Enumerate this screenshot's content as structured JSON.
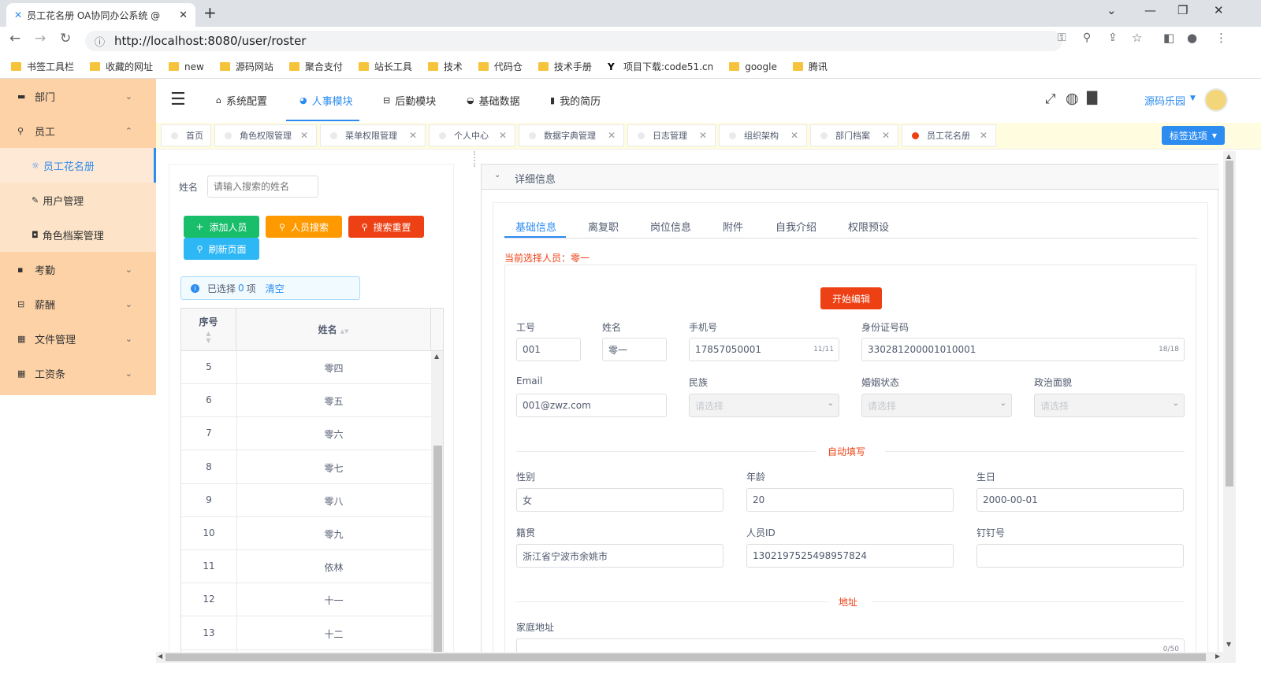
{
  "browser": {
    "tab_title": "员工花名册 OA协同办公系统 @",
    "url": "http://localhost:8080/user/roster",
    "bookmarks": [
      "书签工具栏",
      "收藏的网址",
      "new",
      "源码网站",
      "聚合支付",
      "站长工具",
      "技术",
      "代码仓",
      "技术手册",
      "项目下载:code51.cn",
      "google",
      "腾讯"
    ]
  },
  "sidebar": {
    "items": [
      {
        "label": "部门"
      },
      {
        "label": "员工"
      },
      {
        "label": "员工花名册"
      },
      {
        "label": "用户管理"
      },
      {
        "label": "角色档案管理"
      },
      {
        "label": "考勤"
      },
      {
        "label": "薪酬"
      },
      {
        "label": "文件管理"
      },
      {
        "label": "工资条"
      }
    ]
  },
  "header": {
    "nav": [
      "系统配置",
      "人事模块",
      "后勤模块",
      "基础数据",
      "我的简历"
    ],
    "user": "源码乐园"
  },
  "tags": {
    "items": [
      "首页",
      "角色权限管理",
      "菜单权限管理",
      "个人中心",
      "数据字典管理",
      "日志管理",
      "组织架构",
      "部门档案",
      "员工花名册"
    ],
    "options_label": "标签选项"
  },
  "left": {
    "search_label": "姓名",
    "search_placeholder": "请输入搜索的姓名",
    "buttons": {
      "add": "添加人员",
      "search": "人员搜索",
      "reset": "搜索重置",
      "refresh": "刷新页面"
    },
    "selected_prefix": "已选择",
    "selected_count": "0",
    "selected_suffix": "项",
    "clear": "清空",
    "columns": [
      "序号",
      "姓名"
    ],
    "rows": [
      [
        "5",
        "零四"
      ],
      [
        "6",
        "零五"
      ],
      [
        "7",
        "零六"
      ],
      [
        "8",
        "零七"
      ],
      [
        "9",
        "零八"
      ],
      [
        "10",
        "零九"
      ],
      [
        "11",
        "依林"
      ],
      [
        "12",
        "十一"
      ],
      [
        "13",
        "十二"
      ]
    ]
  },
  "right": {
    "panel_title": "详细信息",
    "tabs": [
      "基础信息",
      "离复职",
      "岗位信息",
      "附件",
      "自我介绍",
      "权限预设"
    ],
    "current_person": "当前选择人员：零一",
    "edit_button": "开始编辑",
    "fields": {
      "work_no": {
        "label": "工号",
        "value": "001"
      },
      "name": {
        "label": "姓名",
        "value": "零一"
      },
      "mobile": {
        "label": "手机号",
        "value": "17857050001",
        "count": "11/11"
      },
      "id_card": {
        "label": "身份证号码",
        "value": "330281200001010001",
        "count": "18/18"
      },
      "email": {
        "label": "Email",
        "value": "001@zwz.com"
      },
      "nation": {
        "label": "民族",
        "placeholder": "请选择"
      },
      "marital": {
        "label": "婚姻状态",
        "placeholder": "请选择"
      },
      "political": {
        "label": "政治面貌",
        "placeholder": "请选择"
      },
      "gender": {
        "label": "性别",
        "value": "女"
      },
      "age": {
        "label": "年龄",
        "value": "20"
      },
      "birthday": {
        "label": "生日",
        "value": "2000-00-01"
      },
      "native": {
        "label": "籍贯",
        "value": "浙江省宁波市余姚市"
      },
      "person_id": {
        "label": "人员ID",
        "value": "1302197525498957824"
      },
      "dingding": {
        "label": "钉钉号",
        "value": ""
      },
      "home_address": {
        "label": "家庭地址",
        "count": "0/50"
      }
    },
    "sections": {
      "auto": "自动填写",
      "address": "地址"
    }
  },
  "colors": {
    "primary": "#2d8cf0",
    "sidebar": "#fdd2a7",
    "success": "#19be6b",
    "warning": "#ff9900",
    "error": "#ed4014",
    "info": "#2db7f5"
  }
}
